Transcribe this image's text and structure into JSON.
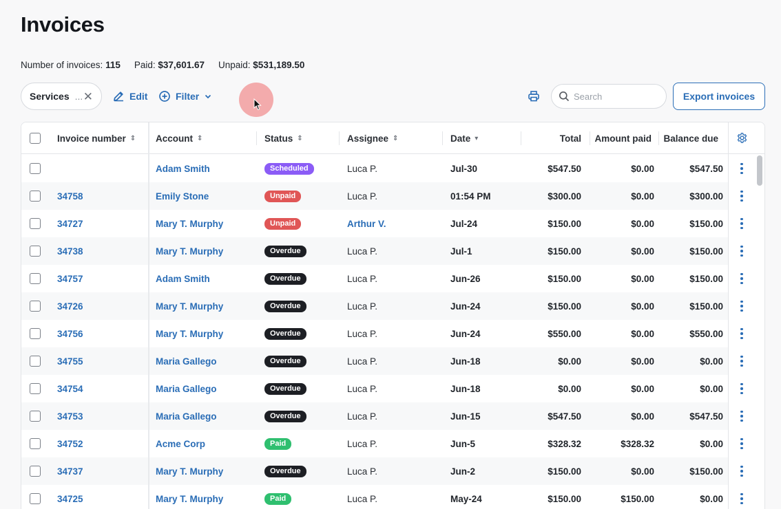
{
  "page": {
    "title": "Invoices"
  },
  "summary": {
    "count_label": "Number of invoices:",
    "count_value": "115",
    "paid_label": "Paid:",
    "paid_value": "$37,601.67",
    "unpaid_label": "Unpaid:",
    "unpaid_value": "$531,189.50"
  },
  "toolbar": {
    "filter_chip": "Services",
    "filter_chip_more": "...",
    "edit_label": "Edit",
    "filter_label": "Filter",
    "search_placeholder": "Search",
    "export_label": "Export invoices"
  },
  "table": {
    "columns": {
      "invoice_number": "Invoice number",
      "account": "Account",
      "status": "Status",
      "assignee": "Assignee",
      "date": "Date",
      "total": "Total",
      "amount_paid": "Amount paid",
      "balance_due": "Balance due"
    },
    "status_colors": {
      "Scheduled": "#8b5cf6",
      "Unpaid": "#e05656",
      "Overdue": "#1d1f24",
      "Paid": "#2fbf6f"
    },
    "rows": [
      {
        "invoice": "",
        "account": "Adam Smith",
        "status": "Scheduled",
        "assignee": "Luca P.",
        "assignee_link": false,
        "date": "Jul-30",
        "total": "$547.50",
        "paid": "$0.00",
        "balance": "$547.50"
      },
      {
        "invoice": "34758",
        "account": "Emily Stone",
        "status": "Unpaid",
        "assignee": "Luca P.",
        "assignee_link": false,
        "date": "01:54 PM",
        "total": "$300.00",
        "paid": "$0.00",
        "balance": "$300.00"
      },
      {
        "invoice": "34727",
        "account": "Mary T. Murphy",
        "status": "Unpaid",
        "assignee": "Arthur V.",
        "assignee_link": true,
        "date": "Jul-24",
        "total": "$150.00",
        "paid": "$0.00",
        "balance": "$150.00"
      },
      {
        "invoice": "34738",
        "account": "Mary T. Murphy",
        "status": "Overdue",
        "assignee": "Luca P.",
        "assignee_link": false,
        "date": "Jul-1",
        "total": "$150.00",
        "paid": "$0.00",
        "balance": "$150.00"
      },
      {
        "invoice": "34757",
        "account": "Adam Smith",
        "status": "Overdue",
        "assignee": "Luca P.",
        "assignee_link": false,
        "date": "Jun-26",
        "total": "$150.00",
        "paid": "$0.00",
        "balance": "$150.00"
      },
      {
        "invoice": "34726",
        "account": "Mary T. Murphy",
        "status": "Overdue",
        "assignee": "Luca P.",
        "assignee_link": false,
        "date": "Jun-24",
        "total": "$150.00",
        "paid": "$0.00",
        "balance": "$150.00"
      },
      {
        "invoice": "34756",
        "account": "Mary T. Murphy",
        "status": "Overdue",
        "assignee": "Luca P.",
        "assignee_link": false,
        "date": "Jun-24",
        "total": "$550.00",
        "paid": "$0.00",
        "balance": "$550.00"
      },
      {
        "invoice": "34755",
        "account": "Maria Gallego",
        "status": "Overdue",
        "assignee": "Luca P.",
        "assignee_link": false,
        "date": "Jun-18",
        "total": "$0.00",
        "paid": "$0.00",
        "balance": "$0.00"
      },
      {
        "invoice": "34754",
        "account": "Maria Gallego",
        "status": "Overdue",
        "assignee": "Luca P.",
        "assignee_link": false,
        "date": "Jun-18",
        "total": "$0.00",
        "paid": "$0.00",
        "balance": "$0.00"
      },
      {
        "invoice": "34753",
        "account": "Maria Gallego",
        "status": "Overdue",
        "assignee": "Luca P.",
        "assignee_link": false,
        "date": "Jun-15",
        "total": "$547.50",
        "paid": "$0.00",
        "balance": "$547.50"
      },
      {
        "invoice": "34752",
        "account": "Acme Corp",
        "status": "Paid",
        "assignee": "Luca P.",
        "assignee_link": false,
        "date": "Jun-5",
        "total": "$328.32",
        "paid": "$328.32",
        "balance": "$0.00"
      },
      {
        "invoice": "34737",
        "account": "Mary T. Murphy",
        "status": "Overdue",
        "assignee": "Luca P.",
        "assignee_link": false,
        "date": "Jun-2",
        "total": "$150.00",
        "paid": "$0.00",
        "balance": "$150.00"
      },
      {
        "invoice": "34725",
        "account": "Mary T. Murphy",
        "status": "Paid",
        "assignee": "Luca P.",
        "assignee_link": false,
        "date": "May-24",
        "total": "$150.00",
        "paid": "$150.00",
        "balance": "$0.00"
      }
    ]
  }
}
